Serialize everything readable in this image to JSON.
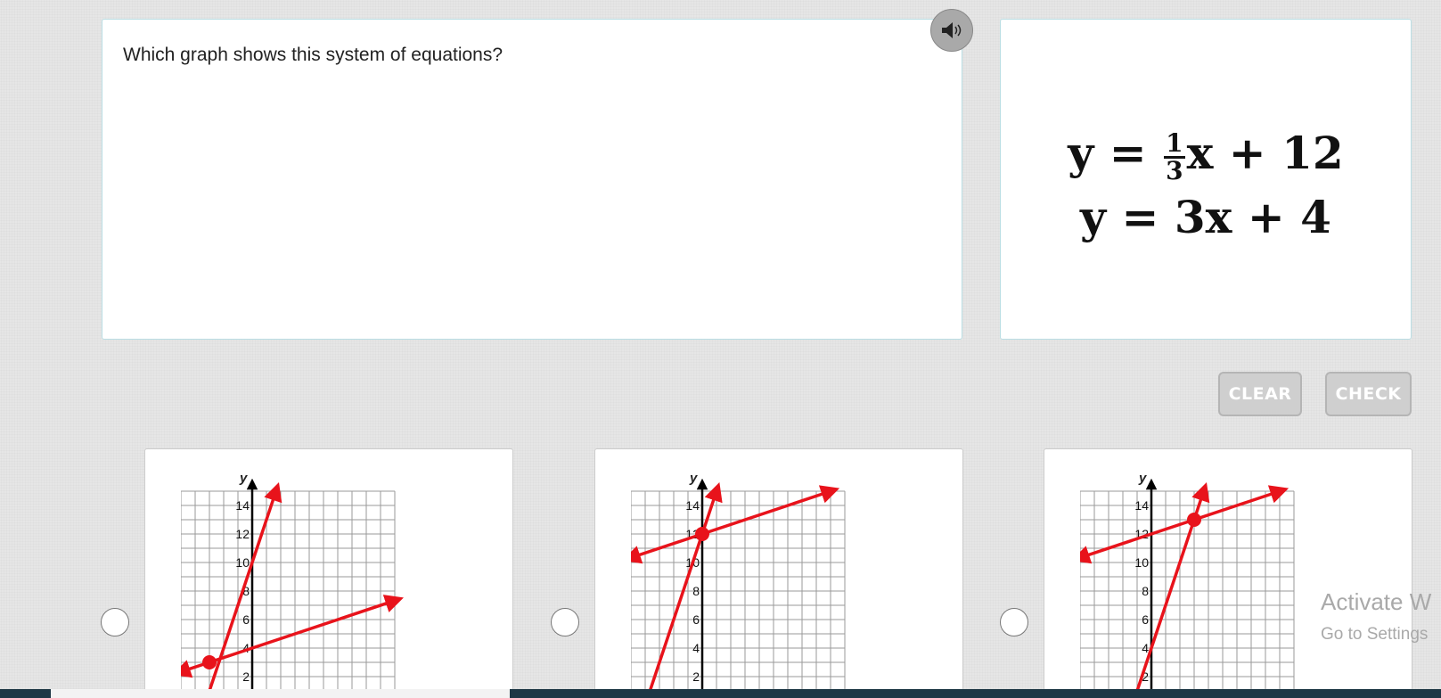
{
  "question": {
    "text": "Which graph shows this system of equations?"
  },
  "equations": {
    "eq1": {
      "lhs": "y",
      "eq": "=",
      "frac_num": "1",
      "frac_den": "3",
      "rest": "x + 12"
    },
    "eq2": {
      "lhs": "y",
      "eq": "=",
      "rest": "3x + 4"
    }
  },
  "buttons": {
    "clear": "CLEAR",
    "check": "CHECK"
  },
  "graph_labels": {
    "y_axis": "y",
    "ticks": [
      "14",
      "12",
      "10",
      "8",
      "6",
      "4",
      "2"
    ]
  },
  "choices": [
    {
      "lines": [
        {
          "slope": 3,
          "intercept": 10
        },
        {
          "slope": 0.333,
          "intercept": 4
        }
      ],
      "intersection": [
        -3,
        3
      ]
    },
    {
      "lines": [
        {
          "slope": 3,
          "intercept": 12
        },
        {
          "slope": 0.333,
          "intercept": 12
        }
      ],
      "intersection": [
        0,
        12
      ]
    },
    {
      "lines": [
        {
          "slope": 3,
          "intercept": 4
        },
        {
          "slope": 0.333,
          "intercept": 12
        }
      ],
      "intersection": [
        3,
        13
      ]
    }
  ],
  "colors": {
    "line": "#e8131b",
    "grid": "#9a9a9a",
    "axis": "#000000"
  },
  "watermark": {
    "line1": "Activate W",
    "line2": "Go to Settings"
  }
}
